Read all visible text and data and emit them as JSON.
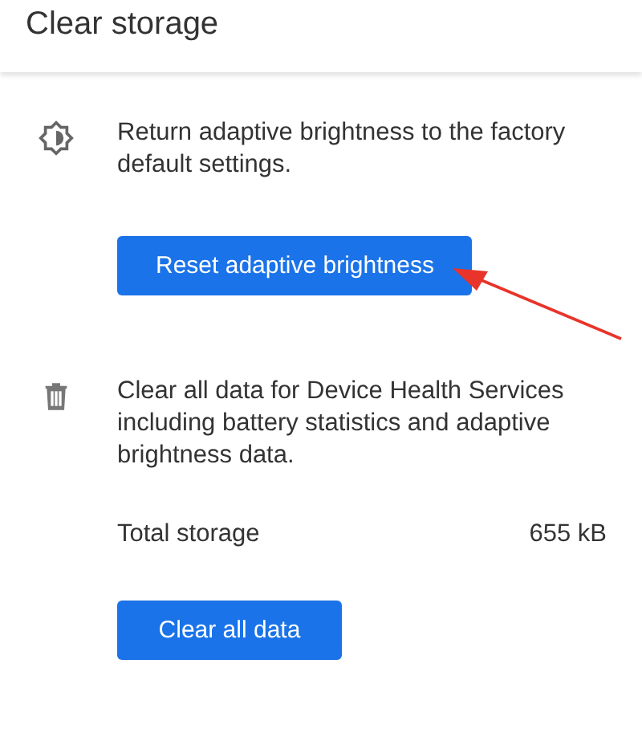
{
  "header": {
    "title": "Clear storage"
  },
  "sections": [
    {
      "kind": "brightness",
      "description": "Return adaptive brightness to the factory default settings.",
      "button": "Reset adaptive brightness"
    },
    {
      "kind": "trash",
      "description": "Clear all data for Device Health Services including battery statistics and adaptive brightness data.",
      "storage": {
        "label": "Total storage",
        "value": "655 kB"
      },
      "button": "Clear all data"
    }
  ]
}
